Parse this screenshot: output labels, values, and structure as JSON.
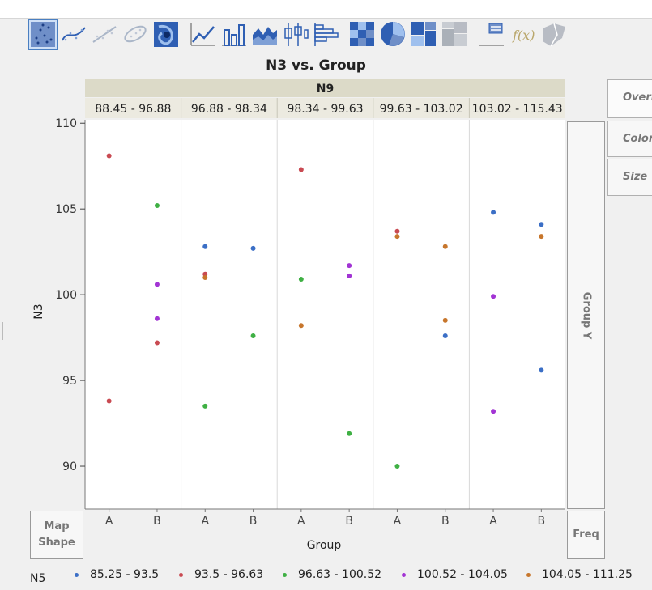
{
  "toolbar": {
    "buttons": [
      {
        "name": "points-icon",
        "active": true
      },
      {
        "name": "smoother-icon"
      },
      {
        "name": "line-of-fit-icon"
      },
      {
        "name": "ellipse-icon"
      },
      {
        "name": "contour-icon"
      },
      {
        "name": "line-icon"
      },
      {
        "name": "bar-icon"
      },
      {
        "name": "area-icon"
      },
      {
        "name": "box-plot-icon"
      },
      {
        "name": "histogram-icon"
      },
      {
        "name": "heatmap-icon"
      },
      {
        "name": "pie-icon"
      },
      {
        "name": "treemap-icon"
      },
      {
        "name": "mosaic-icon"
      },
      {
        "name": "caption-box-icon"
      },
      {
        "name": "formula-icon"
      },
      {
        "name": "map-shapes-icon"
      }
    ]
  },
  "controls": {
    "map_shape_label": "Map Shape",
    "freq_label": "Freq",
    "group_y_label": "Group Y",
    "right_tabs": [
      "Overlay",
      "Color",
      "Size"
    ]
  },
  "colors": {
    "85.25 - 93.5": "#3b6fc6",
    "93.5 - 96.63": "#c94a52",
    "96.63 - 100.52": "#3fb044",
    "100.52 - 104.05": "#a234d4",
    "104.05 - 111.25": "#c7762c"
  },
  "chart_data": {
    "type": "scatter",
    "title": "N3 vs. Group",
    "xlabel": "Group",
    "ylabel": "N3",
    "wrap_title": "N9",
    "panels": [
      "88.45 - 96.88",
      "96.88 - 98.34",
      "98.34 - 99.63",
      "99.63 - 103.02",
      "103.02 - 115.43"
    ],
    "categories": [
      "A",
      "B"
    ],
    "y_ticks": [
      90,
      95,
      100,
      105,
      110
    ],
    "ylim": [
      87.5,
      110.2
    ],
    "legend_title": "N5",
    "legend_placement": "bottom",
    "series": [
      {
        "name": "85.25 - 93.5",
        "points": [
          {
            "panel": 1,
            "x": "A",
            "y": 102.8
          },
          {
            "panel": 1,
            "x": "B",
            "y": 102.7
          },
          {
            "panel": 3,
            "x": "B",
            "y": 97.6
          },
          {
            "panel": 4,
            "x": "A",
            "y": 104.8
          },
          {
            "panel": 4,
            "x": "B",
            "y": 104.1
          },
          {
            "panel": 4,
            "x": "B",
            "y": 95.6
          }
        ]
      },
      {
        "name": "93.5 - 96.63",
        "points": [
          {
            "panel": 0,
            "x": "A",
            "y": 108.1
          },
          {
            "panel": 0,
            "x": "A",
            "y": 93.8
          },
          {
            "panel": 0,
            "x": "B",
            "y": 97.2
          },
          {
            "panel": 1,
            "x": "A",
            "y": 101.2
          },
          {
            "panel": 2,
            "x": "A",
            "y": 107.3
          },
          {
            "panel": 3,
            "x": "A",
            "y": 103.7
          }
        ]
      },
      {
        "name": "96.63 - 100.52",
        "points": [
          {
            "panel": 0,
            "x": "B",
            "y": 105.2
          },
          {
            "panel": 1,
            "x": "A",
            "y": 93.5
          },
          {
            "panel": 1,
            "x": "B",
            "y": 97.6
          },
          {
            "panel": 2,
            "x": "A",
            "y": 100.9
          },
          {
            "panel": 2,
            "x": "B",
            "y": 91.9
          },
          {
            "panel": 3,
            "x": "A",
            "y": 90.0
          }
        ]
      },
      {
        "name": "100.52 - 104.05",
        "points": [
          {
            "panel": 0,
            "x": "B",
            "y": 100.6
          },
          {
            "panel": 0,
            "x": "B",
            "y": 98.6
          },
          {
            "panel": 2,
            "x": "B",
            "y": 101.7
          },
          {
            "panel": 2,
            "x": "B",
            "y": 101.1
          },
          {
            "panel": 4,
            "x": "A",
            "y": 99.9
          },
          {
            "panel": 4,
            "x": "A",
            "y": 93.2
          }
        ]
      },
      {
        "name": "104.05 - 111.25",
        "points": [
          {
            "panel": 1,
            "x": "A",
            "y": 101.0
          },
          {
            "panel": 2,
            "x": "A",
            "y": 98.2
          },
          {
            "panel": 3,
            "x": "A",
            "y": 103.4
          },
          {
            "panel": 3,
            "x": "B",
            "y": 102.8
          },
          {
            "panel": 3,
            "x": "B",
            "y": 98.5
          },
          {
            "panel": 4,
            "x": "B",
            "y": 103.4
          }
        ]
      }
    ]
  }
}
